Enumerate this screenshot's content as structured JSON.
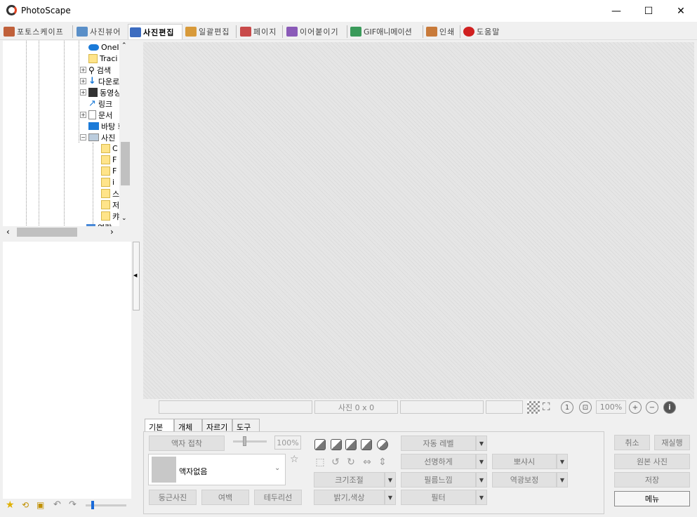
{
  "window": {
    "title": "PhotoScape",
    "minimize": "—",
    "maximize": "☐",
    "close": "✕"
  },
  "tabs": [
    {
      "label": "포토스케이프",
      "color": "#c0603a"
    },
    {
      "label": "사진뷰어",
      "color": "#5a8fc8"
    },
    {
      "label": "사진편집",
      "color": "#3c6cc0"
    },
    {
      "label": "일괄편집",
      "color": "#d89a3a"
    },
    {
      "label": "페이지",
      "color": "#c84a4a"
    },
    {
      "label": "이어붙이기",
      "color": "#8a5ab8"
    },
    {
      "label": "GIF애니메이션",
      "color": "#3a9a5a"
    },
    {
      "label": "인쇄",
      "color": "#c87a3a"
    },
    {
      "label": "도움말",
      "color": "#d02020"
    }
  ],
  "tree": {
    "items": [
      "OneI",
      "Traci",
      "검색",
      "다운로",
      "동영싱",
      "링크",
      "문서",
      "바탕 화",
      "사진",
      "C",
      "F",
      "F",
      "i",
      "스",
      "저",
      "캬",
      "연락"
    ]
  },
  "status": {
    "size": "사진 0 x 0",
    "zoom": "100%"
  },
  "bottom_tabs": [
    "기본",
    "개체",
    "자르기",
    "도구"
  ],
  "basic": {
    "frame_fit": "액자 접착",
    "percent": "100%",
    "frame_name": "액자없음",
    "round": "둥근사진",
    "margin": "여백",
    "border": "테두리선",
    "resize": "크기조절",
    "bright": "밝기,색상",
    "auto_level": "자동 레벨",
    "sharpen": "선명하게",
    "film": "필름느낌",
    "filter": "필터",
    "fade": "뽀샤시",
    "backlight": "역광보정"
  },
  "actions": {
    "undo": "취소",
    "redo": "재실행",
    "original": "원본 사진",
    "save": "저장",
    "menu": "메뉴"
  }
}
